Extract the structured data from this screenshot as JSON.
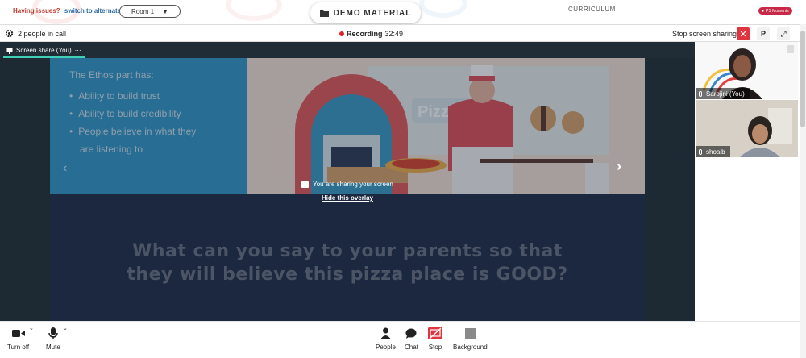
{
  "top": {
    "issues_text": "Having issues?",
    "alternate_link": "switch to alternate room",
    "room_select": "Room 1",
    "demo_material": "DEMO MATERIAL",
    "curriculum": "CURRICULUM",
    "moments_badge": "PS Moments"
  },
  "call": {
    "people_count": "2 people in call",
    "recording_label": "Recording",
    "recording_time": "32:49",
    "stop_screen_sharing": "Stop screen sharing",
    "close_label": "✕",
    "p_label": "P",
    "expand_label": "⤢"
  },
  "stage": {
    "tab_label": "Screen share (You)",
    "tab_more": "···",
    "slide": {
      "heading": "The Ethos part has:",
      "bullets": [
        "Ability to build trust",
        "Ability to build credibility",
        "People believe in what they"
      ],
      "bullet_cont": "are listening to",
      "sign_text": "Pizza",
      "question_line1": "What can you say to your parents so that",
      "question_line2": "they will believe this pizza place is GOOD?"
    },
    "sharing_message": "You are sharing your screen",
    "hide_overlay": "Hide this overlay"
  },
  "participants": [
    {
      "name": "Sarojini (You)"
    },
    {
      "name": "shoaib"
    }
  ],
  "toolbar": {
    "turn_off": "Turn off",
    "mute": "Mute",
    "people": "People",
    "chat": "Chat",
    "stop": "Stop",
    "background": "Background"
  },
  "colors": {
    "record_red": "#e02424",
    "accent_teal": "#3fd0b6",
    "slide_blue": "#3399c8",
    "stop_red": "#e0343f"
  }
}
